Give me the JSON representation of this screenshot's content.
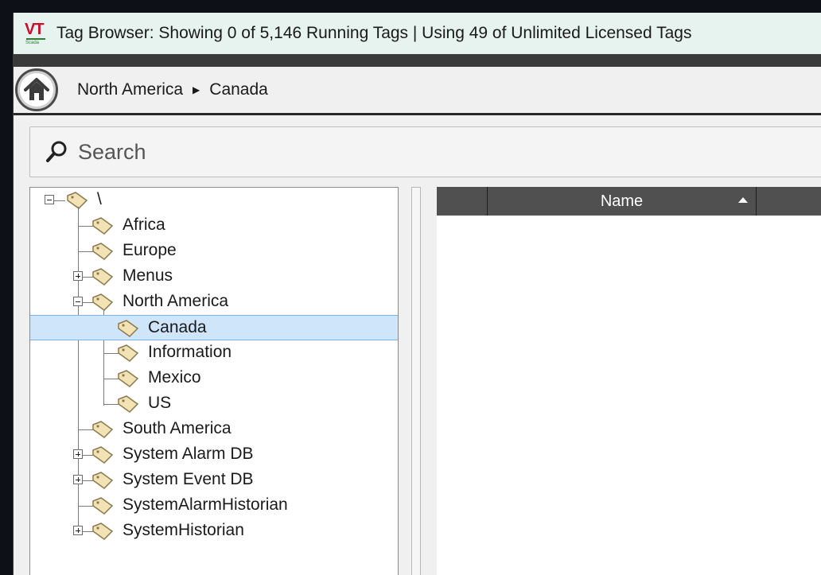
{
  "window": {
    "title": "Tag Browser: Showing 0 of 5,146 Running Tags | Using 49 of Unlimited Licensed Tags",
    "logo_text": "VT",
    "logo_subtext": "Scada"
  },
  "breadcrumb": {
    "items": [
      "North America",
      "Canada"
    ],
    "separator": "▶"
  },
  "search": {
    "placeholder": "Search",
    "value": ""
  },
  "tree": {
    "root": "\\",
    "items": [
      {
        "label": "Africa",
        "level": 1,
        "expander": "none"
      },
      {
        "label": "Europe",
        "level": 1,
        "expander": "none"
      },
      {
        "label": "Menus",
        "level": 1,
        "expander": "plus"
      },
      {
        "label": "North America",
        "level": 1,
        "expander": "minus"
      },
      {
        "label": "Canada",
        "level": 2,
        "expander": "none",
        "selected": true
      },
      {
        "label": "Information",
        "level": 2,
        "expander": "none"
      },
      {
        "label": "Mexico",
        "level": 2,
        "expander": "none"
      },
      {
        "label": "US",
        "level": 2,
        "expander": "none"
      },
      {
        "label": "South America",
        "level": 1,
        "expander": "none"
      },
      {
        "label": "System Alarm DB",
        "level": 1,
        "expander": "plus"
      },
      {
        "label": "System Event DB",
        "level": 1,
        "expander": "plus"
      },
      {
        "label": "SystemAlarmHistorian",
        "level": 1,
        "expander": "none"
      },
      {
        "label": "SystemHistorian",
        "level": 1,
        "expander": "plus"
      }
    ]
  },
  "list": {
    "columns": [
      "Name"
    ],
    "sort_direction": "ascending",
    "rows": []
  },
  "colors": {
    "titlebar_bg": "#e7f3ef",
    "selection_bg": "#cfe5fa",
    "header_bg": "#505050",
    "tag_icon_fill": "#f3e2b3"
  }
}
